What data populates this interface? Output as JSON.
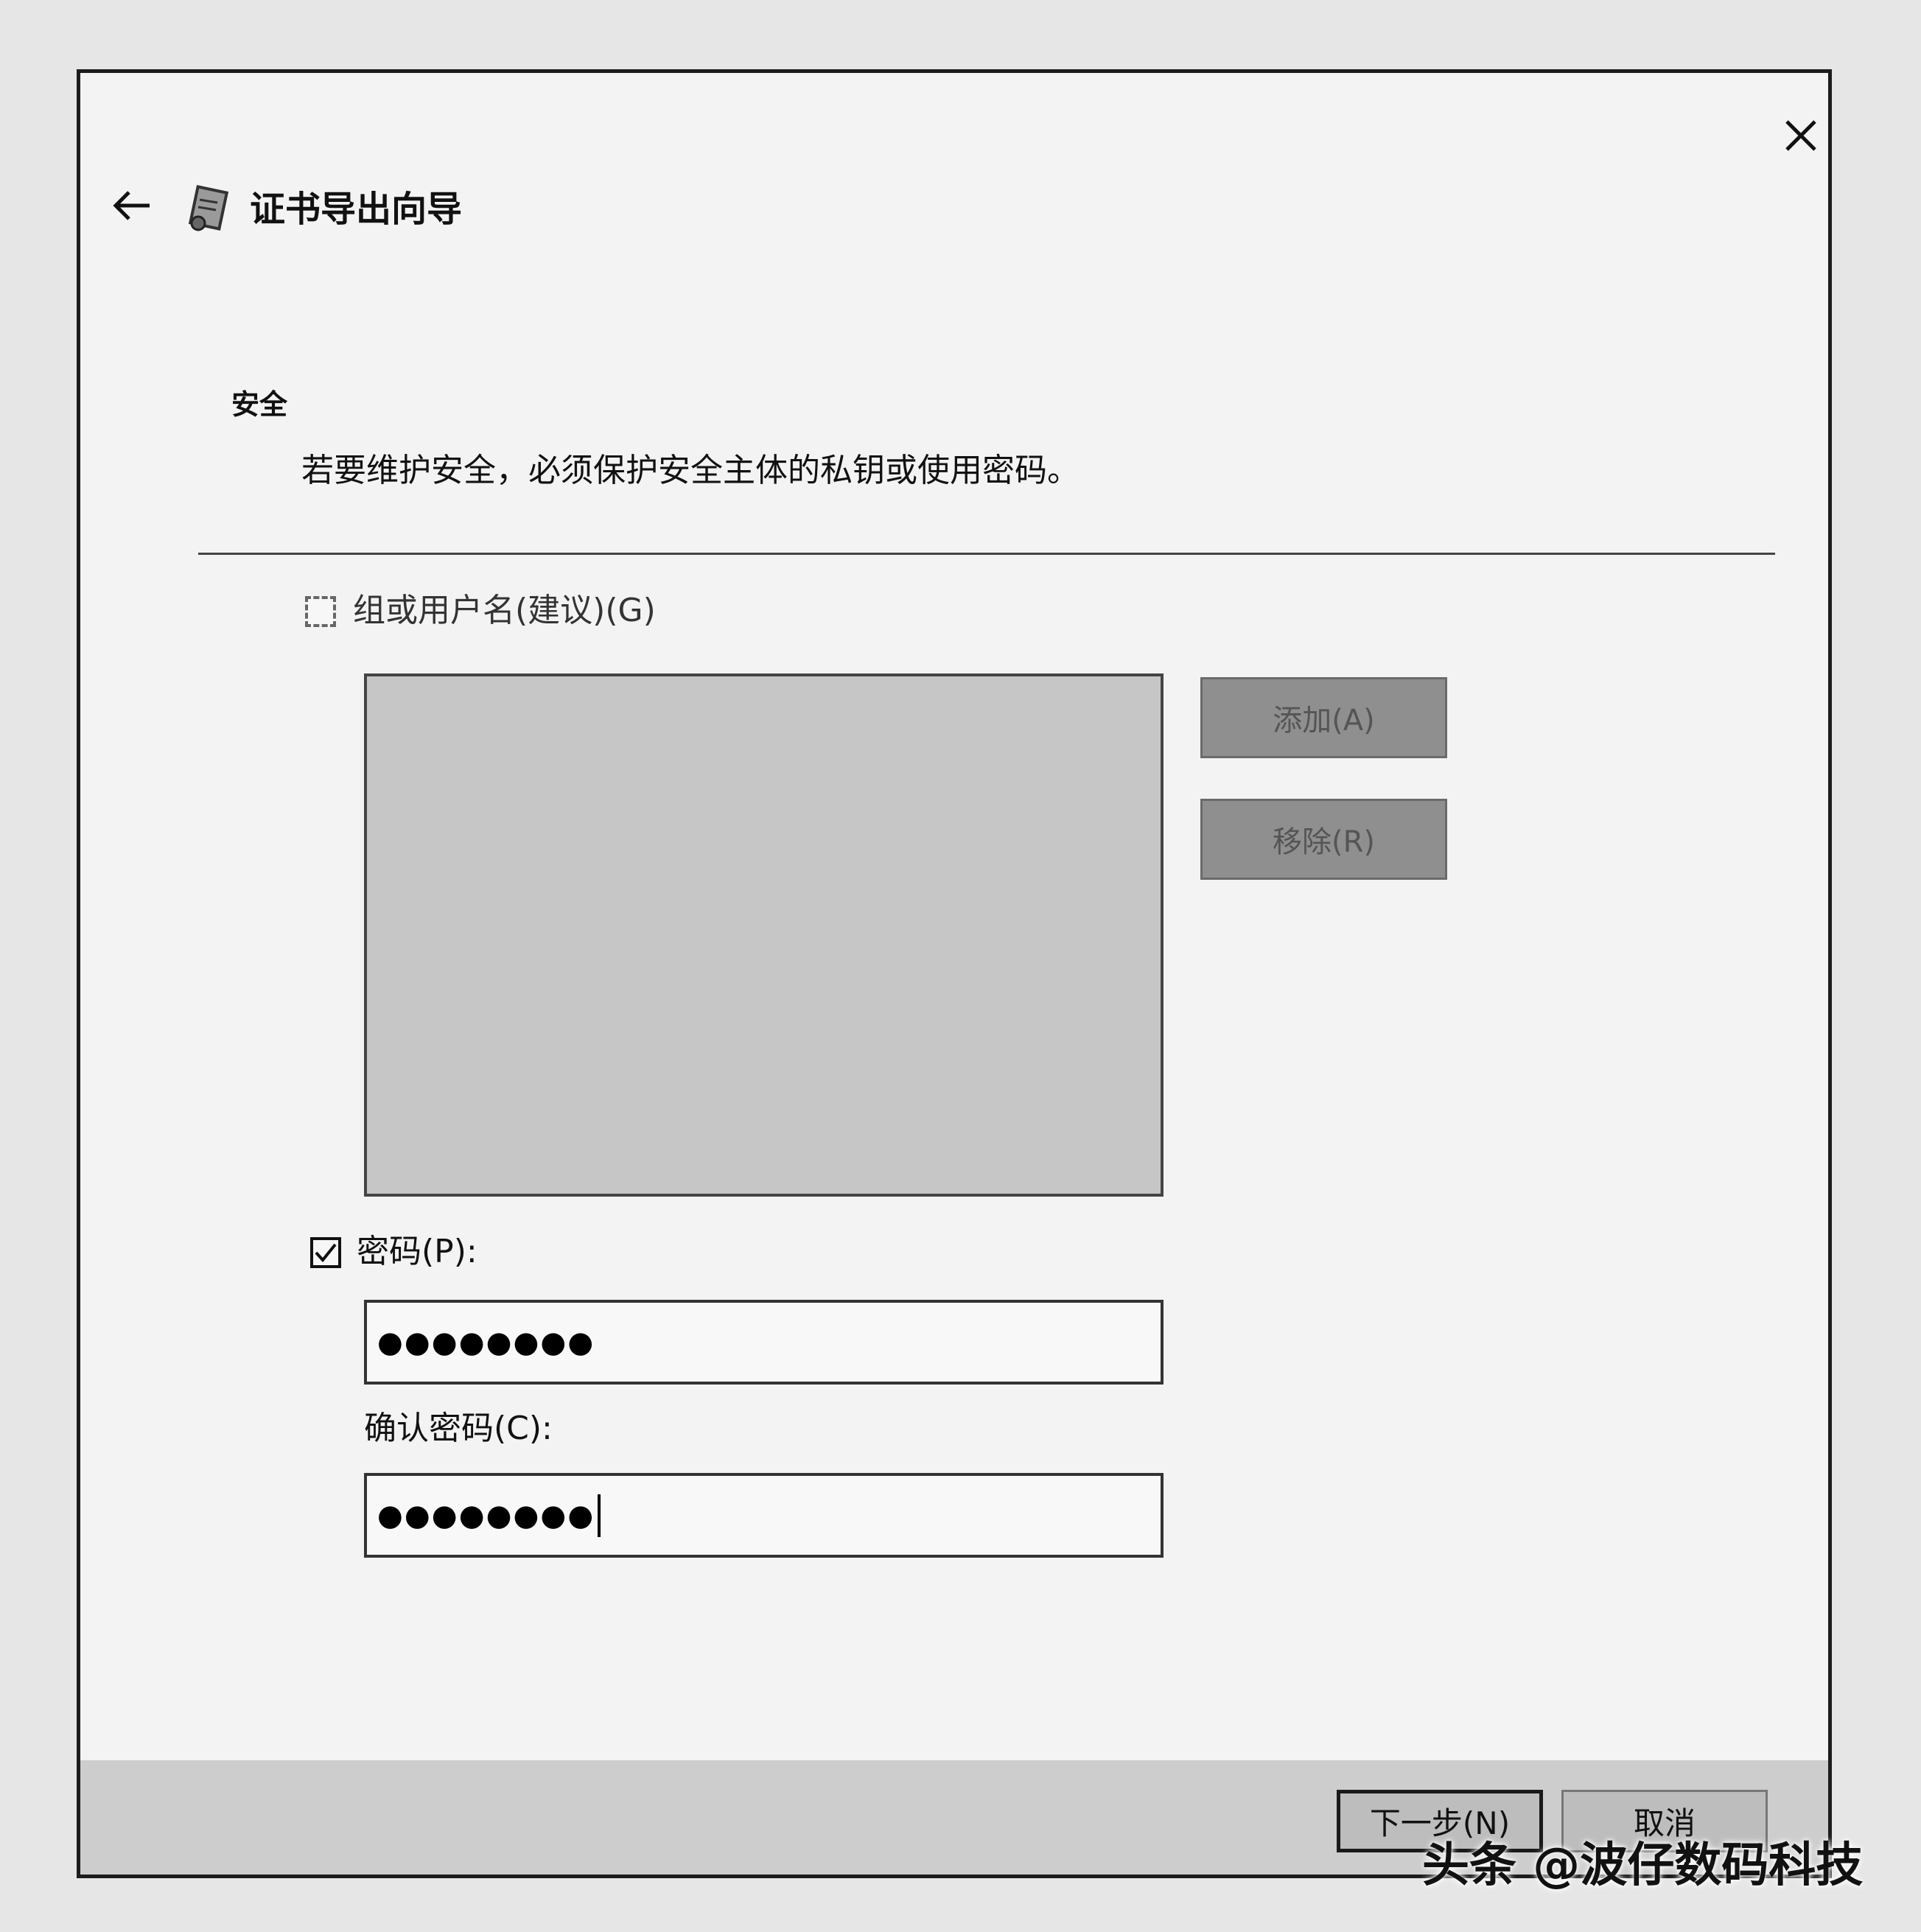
{
  "header": {
    "title": "证书导出向导"
  },
  "section": {
    "heading": "安全",
    "description": "若要维护安全，必须保护安全主体的私钥或使用密码。"
  },
  "groups_option": {
    "label": "组或用户名(建议)(G)",
    "checked": false,
    "enabled": false
  },
  "principal_buttons": {
    "add_label": "添加(A)",
    "remove_label": "移除(R)"
  },
  "password_option": {
    "label": "密码(P):",
    "checked": true
  },
  "password_field": {
    "masked_value": "●●●●●●●●"
  },
  "confirm_field": {
    "label": "确认密码(C):",
    "masked_value": "●●●●●●●●"
  },
  "footer": {
    "next_label": "下一步(N)",
    "cancel_label": "取消"
  },
  "watermark": {
    "text": "头条 @波仔数码科技"
  },
  "icons": {
    "close": "close-icon",
    "back": "back-arrow-icon",
    "wizard": "certificate-wizard-icon",
    "checkmark": "checkmark-icon"
  }
}
